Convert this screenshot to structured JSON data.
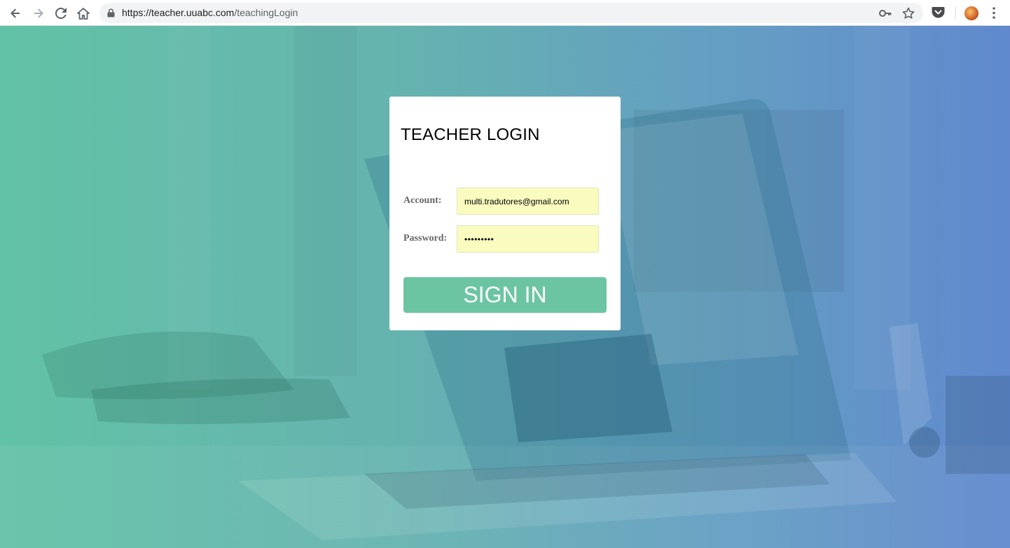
{
  "browser": {
    "url_host": "https://teacher.uuabc.com",
    "url_path": "/teachingLogin",
    "icons": [
      "back-arrow-icon",
      "forward-arrow-icon",
      "reload-icon",
      "home-icon",
      "lock-icon",
      "key-icon",
      "star-icon",
      "pocket-icon",
      "profile-avatar",
      "more-vert-icon"
    ]
  },
  "login": {
    "title": "TEACHER LOGIN",
    "account_label": "Account:",
    "account_value": "multi.tradutores@gmail.com",
    "password_label": "Password:",
    "password_value": "123456789",
    "signin_label": "SIGN IN"
  },
  "colors": {
    "button": "#6cc5a2",
    "autofill": "#fafcbf",
    "gradient_left": "#5dc0a4",
    "gradient_right": "#5b86cd"
  }
}
